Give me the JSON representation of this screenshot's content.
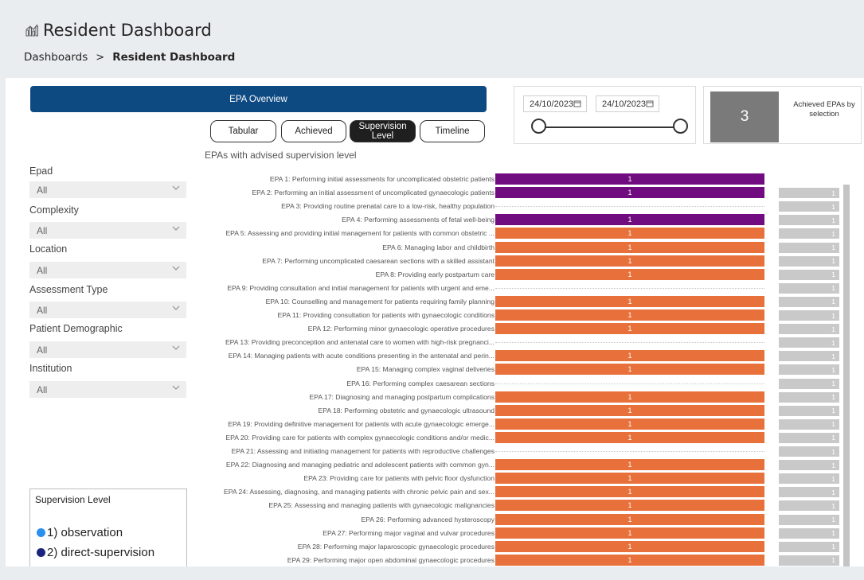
{
  "header": {
    "title": "Resident Dashboard",
    "breadcrumb_root": "Dashboards",
    "breadcrumb_separator": ">",
    "breadcrumb_current": "Resident Dashboard"
  },
  "panel": {
    "epa_overview_label": "EPA Overview",
    "tabs": [
      "Tabular",
      "Achieved",
      "Supervision Level",
      "Timeline"
    ],
    "active_tab": "Supervision Level",
    "chart_subtitle": "EPAs with advised supervision level"
  },
  "filters": [
    {
      "label": "Epad",
      "value": "All"
    },
    {
      "label": "Complexity",
      "value": "All"
    },
    {
      "label": "Location",
      "value": "All"
    },
    {
      "label": "Assessment Type",
      "value": "All"
    },
    {
      "label": "Patient Demographic",
      "value": "All"
    },
    {
      "label": "Institution",
      "value": "All"
    }
  ],
  "legend": {
    "title": "Supervision Level",
    "items": [
      {
        "label": "1) observation",
        "color": "#2b8ff0"
      },
      {
        "label": "2) direct-supervision",
        "color": "#1a237e"
      }
    ]
  },
  "date_range": {
    "start": "24/10/2023",
    "end": "24/10/2023"
  },
  "kpi": {
    "value": "3",
    "label": "Achieved EPAs by selection"
  },
  "colors": {
    "purple": "#700c7f",
    "orange": "#e8703a",
    "header_blue": "#0e4a82",
    "gray_bar": "#c9c9c9"
  },
  "chart_data": {
    "type": "bar",
    "categories": [
      "EPA 1: Performing initial assessments for uncomplicated obstetric patients",
      "EPA 2: Performing an initial assessment of uncomplicated gynaecologic patients",
      "EPA 3: Providing routine prenatal care to a low-risk, healthy population",
      "EPA 4: Performing assessments of fetal well-being",
      "EPA 5: Assessing and providing initial management for patients with common obstetric ...",
      "EPA 6: Managing labor and childbirth",
      "EPA 7: Performing uncomplicated caesarean sections with a skilled assistant",
      "EPA 8: Providing early postpartum care",
      "EPA 9: Providing consultation and initial management for patients with urgent and eme...",
      "EPA 10: Counselling and management for patients requiring family planning",
      "EPA 11: Providing consultation for patients with gynaecologic conditions",
      "EPA 12: Performing minor gynaecologic operative procedures",
      "EPA 13: Providing preconception and antenatal care to women with high-risk pregnanci...",
      "EPA 14: Managing patients with acute conditions presenting in the antenatal and perin...",
      "EPA 15: Managing complex vaginal deliveries",
      "EPA 16: Performing complex caesarean sections",
      "EPA 17: Diagnosing and managing postpartum complications",
      "EPA 18: Performing obstetric and gynaecologic ultrasound",
      "EPA 19: Providing definitive management for patients with acute gynaecologic emerge...",
      "EPA 20: Providing care for patients with complex gynaecologic conditions and/or medic...",
      "EPA 21: Assessing and initiating management for patients with reproductive challenges",
      "EPA 22: Diagnosing and managing pediatric and adolescent patients with common gyn...",
      "EPA 23: Providing care for patients with pelvic floor dysfunction",
      "EPA 24: Assessing, diagnosing, and managing patients with chronic pelvic pain and sex...",
      "EPA 25: Assessing and managing patients with gynaecologic malignancies",
      "EPA 26: Performing advanced hysteroscopy",
      "EPA 27: Performing major vaginal and vulvar procedures",
      "EPA 28: Performing major laparoscopic gynaecologic procedures",
      "EPA 29: Performing major open abdominal gynaecologic procedures"
    ],
    "values": [
      1,
      1,
      null,
      1,
      1,
      1,
      1,
      1,
      null,
      1,
      1,
      1,
      null,
      1,
      1,
      null,
      1,
      1,
      1,
      1,
      null,
      1,
      1,
      1,
      1,
      1,
      1,
      1,
      1
    ],
    "colors": [
      "purple",
      "purple",
      null,
      "purple",
      "orange",
      "orange",
      "orange",
      "orange",
      null,
      "orange",
      "orange",
      "orange",
      null,
      "orange",
      "orange",
      null,
      "orange",
      "orange",
      "orange",
      "orange",
      null,
      "orange",
      "orange",
      "orange",
      "orange",
      "orange",
      "orange",
      "orange",
      "orange"
    ],
    "achieved_values": [
      null,
      1,
      1,
      1,
      1,
      1,
      1,
      1,
      1,
      1,
      1,
      1,
      1,
      1,
      1,
      1,
      1,
      1,
      1,
      1,
      1,
      1,
      1,
      1,
      1,
      1,
      1,
      1,
      1
    ],
    "title": "EPAs with advised supervision level"
  }
}
